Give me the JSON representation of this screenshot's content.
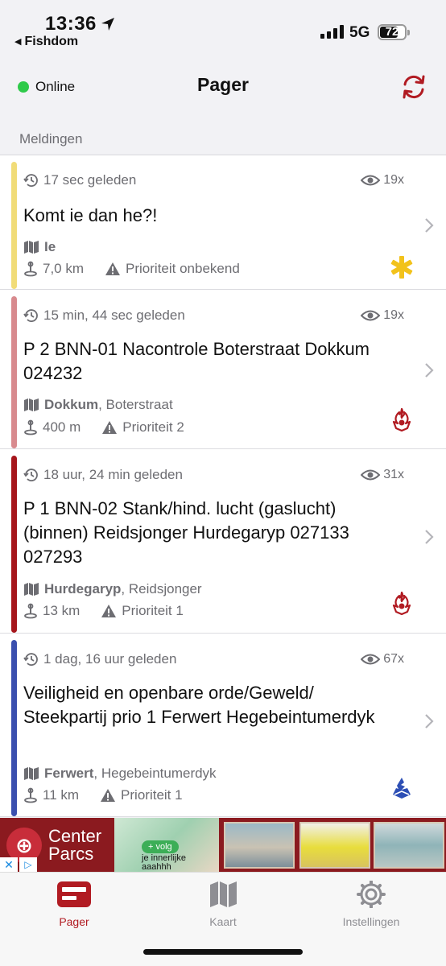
{
  "status_bar": {
    "time": "13:36",
    "back_app": "Fishdom",
    "network": "5G",
    "battery": "72"
  },
  "nav": {
    "status_label": "Online",
    "title": "Pager"
  },
  "section": {
    "header": "Meldingen"
  },
  "messages": [
    {
      "time_ago": "17 sec geleden",
      "views": "19x",
      "title": "Komt ie dan he?!",
      "place_bold": "Ie",
      "place_rest": "",
      "distance": "7,0 km",
      "priority": "Prioriteit onbekend",
      "bar_color": "#f1dc78",
      "badge": "star-of-life-icon"
    },
    {
      "time_ago": "15 min, 44 sec geleden",
      "views": "19x",
      "title": "P 2 BNN-01 Nacontrole Boterstraat Dokkum 024232",
      "place_bold": "Dokkum",
      "place_rest": ", Boterstraat",
      "distance": "400 m",
      "priority": "Prioriteit 2",
      "bar_color": "#d88a8e",
      "badge": "fire-department-icon"
    },
    {
      "time_ago": "18 uur, 24 min geleden",
      "views": "31x",
      "title": "P 1 BNN-02 Stank/hind. lucht (gaslucht) (binnen) Reidsjonger Hurdegaryp 027133 027293",
      "place_bold": "Hurdegaryp",
      "place_rest": ", Reidsjonger",
      "distance": "13 km",
      "priority": "Prioriteit 1",
      "bar_color": "#a6161c",
      "badge": "fire-department-icon"
    },
    {
      "time_ago": "1 dag, 16 uur geleden",
      "views": "67x",
      "title": "Veiligheid en openbare orde/Geweld/ Steekpartij prio 1 Ferwert Hegebeintumerdyk",
      "place_bold": "Ferwert",
      "place_rest": ", Hegebeintumerdyk",
      "distance": "11 km",
      "priority": "Prioriteit 1",
      "bar_color": "#3a4fae",
      "badge": "police-icon"
    }
  ],
  "ad": {
    "brand": "Center Parcs",
    "pill": "+ volg",
    "tagline": "je innerlijke aaahhh"
  },
  "tabs": [
    {
      "label": "Pager",
      "icon": "pager-icon",
      "active": true
    },
    {
      "label": "Kaart",
      "icon": "map-icon",
      "active": false
    },
    {
      "label": "Instellingen",
      "icon": "settings-icon",
      "active": false
    }
  ],
  "colors": {
    "accent": "#b11b22",
    "online": "#2fca4a",
    "secondary_text": "#6d6d72"
  }
}
